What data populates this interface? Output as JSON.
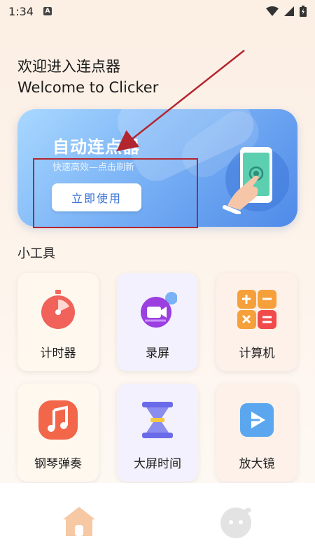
{
  "status_bar": {
    "time": "1:34",
    "notification_glyph": "A"
  },
  "welcome": {
    "line_cn": "欢迎进入连点器",
    "line_en": "Welcome to Clicker"
  },
  "banner": {
    "title": "自动连点器",
    "subtitle": "快速高效—点击刷新",
    "button_label": "立即使用"
  },
  "tools_section": {
    "title": "小工具",
    "items": [
      {
        "label": "计时器",
        "icon": "stopwatch-icon"
      },
      {
        "label": "录屏",
        "icon": "screen-record-icon"
      },
      {
        "label": "计算机",
        "icon": "calculator-icon"
      },
      {
        "label": "钢琴弹奏",
        "icon": "music-note-icon"
      },
      {
        "label": "大屏时间",
        "icon": "hourglass-icon"
      },
      {
        "label": "放大镜",
        "icon": "magnifier-play-icon"
      }
    ]
  },
  "bottom_nav": {
    "items": [
      {
        "name": "home",
        "icon": "home-icon",
        "active": true
      },
      {
        "name": "profile",
        "icon": "mascot-face-icon",
        "active": false
      }
    ]
  },
  "colors": {
    "accent_blue": "#4f8ae8",
    "annotation_red": "#b3262f",
    "home_active": "#f6c9a4",
    "nav_inactive": "#e3e3e3"
  }
}
